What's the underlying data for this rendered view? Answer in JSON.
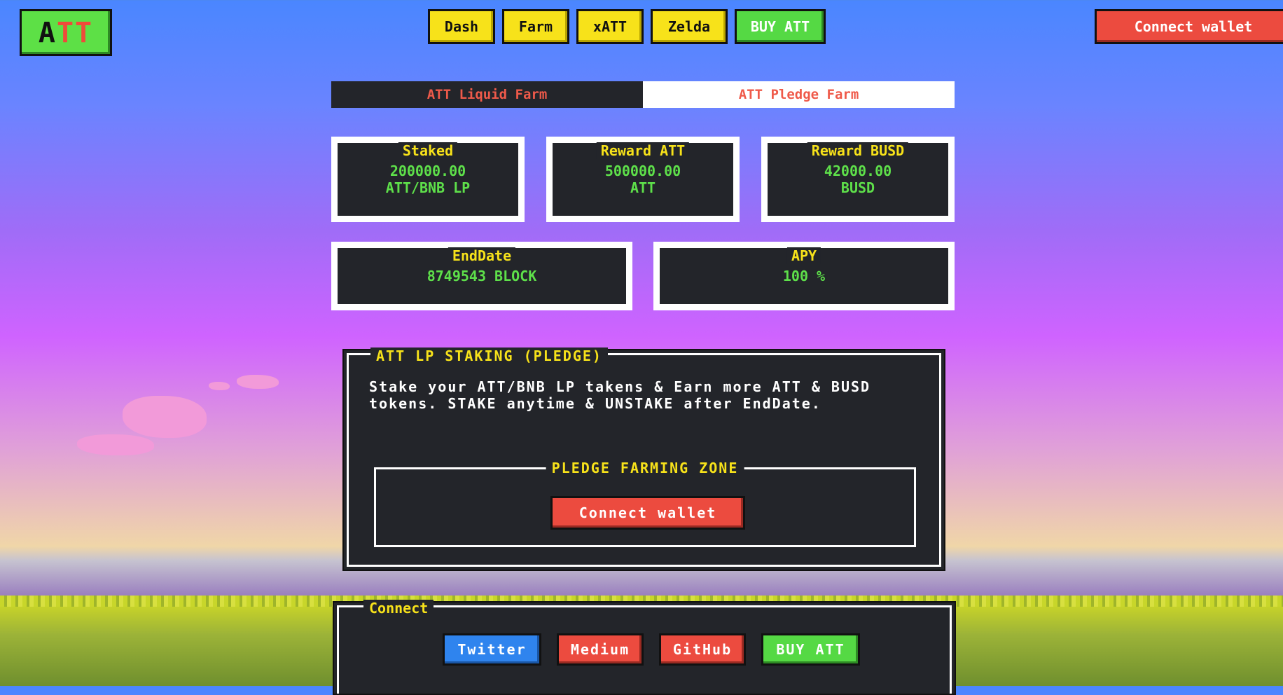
{
  "header": {
    "logo": {
      "a": "A",
      "tt": "TT"
    },
    "nav": [
      {
        "label": "Dash"
      },
      {
        "label": "Farm"
      },
      {
        "label": "xATT"
      },
      {
        "label": "Zelda"
      }
    ],
    "buy_label": "BUY ATT",
    "connect_wallet_label": "Connect wallet"
  },
  "tabs": [
    {
      "label": "ATT Liquid Farm",
      "active": false
    },
    {
      "label": "ATT Pledge Farm",
      "active": true
    }
  ],
  "stats": {
    "staked": {
      "label": "Staked",
      "value": "200000.00",
      "unit": "ATT/BNB LP"
    },
    "reward_att": {
      "label": "Reward ATT",
      "value": "500000.00",
      "unit": "ATT"
    },
    "reward_busd": {
      "label": "Reward BUSD",
      "value": "42000.00",
      "unit": "BUSD"
    },
    "end_date": {
      "label": "EndDate",
      "value": "8749543 BLOCK"
    },
    "apy": {
      "label": "APY",
      "value": "100 %"
    }
  },
  "staking": {
    "title": "ATT LP STAKING (PLEDGE)",
    "description": "Stake your ATT/BNB LP takens & Earn more ATT & BUSD tokens. STAKE anytime & UNSTAKE after EndDate.",
    "zone_title": "PLEDGE FARMING ZONE",
    "connect_wallet_label": "Connect wallet"
  },
  "footer": {
    "title": "Connect",
    "links": [
      {
        "label": "Twitter"
      },
      {
        "label": "Medium"
      },
      {
        "label": "GitHub"
      },
      {
        "label": "BUY ATT"
      }
    ]
  },
  "colors": {
    "accent_yellow": "#f7e21a",
    "accent_green": "#55d944",
    "accent_red": "#ec4b3f",
    "accent_blue": "#2f84ee",
    "panel_dark": "#23252a",
    "value_green": "#5ee04a"
  }
}
